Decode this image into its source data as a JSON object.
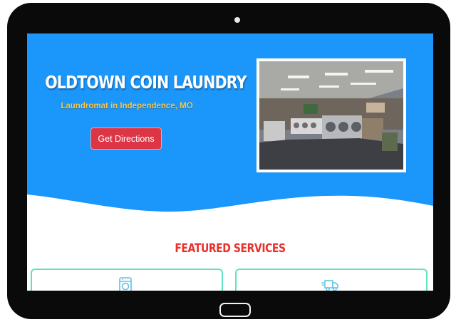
{
  "hero": {
    "title": "OLDTOWN COIN LAUNDRY",
    "subtitle": "Laundromat in Independence, MO",
    "cta_label": "Get Directions",
    "bg_color": "#1b96fb",
    "title_color": "#ffffff",
    "subtitle_color": "#f5c64a",
    "cta_color": "#dc3545"
  },
  "services": {
    "heading": "FEATURED SERVICES",
    "heading_color": "#e8312d",
    "card_border_color": "#5be4c0",
    "cards": [
      {
        "icon": "washing-machine-icon"
      },
      {
        "icon": "delivery-truck-icon"
      }
    ]
  }
}
